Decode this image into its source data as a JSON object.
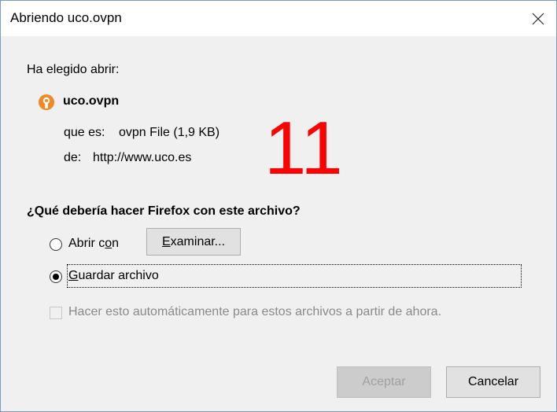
{
  "dialog": {
    "title": "Abriendo uco.ovpn",
    "close_icon": "close-icon"
  },
  "info": {
    "intro": "Ha elegido abrir:",
    "file_icon": "openvpn-file-icon",
    "file_name": "uco.ovpn",
    "type_label": "que es:",
    "type_value": "ovpn File (1,9 KB)",
    "from_label": "de:",
    "from_value": "http://www.uco.es"
  },
  "overlay": {
    "number": "11",
    "color": "#ff0000"
  },
  "action": {
    "question": "¿Qué debería hacer Firefox con este archivo?",
    "open_with_label_pre": "Abrir c",
    "open_with_label_accel": "o",
    "open_with_label_post": "n",
    "open_with_selected": false,
    "browse_pre": "",
    "browse_accel": "E",
    "browse_post": "xaminar...",
    "save_label_pre": "",
    "save_label_accel": "G",
    "save_label_post": "uardar archivo",
    "save_selected": true,
    "auto_checkbox_label": "Hacer esto automáticamente para estos archivos a partir de ahora.",
    "auto_checked": false
  },
  "buttons": {
    "accept": "Aceptar",
    "cancel": "Cancelar"
  }
}
